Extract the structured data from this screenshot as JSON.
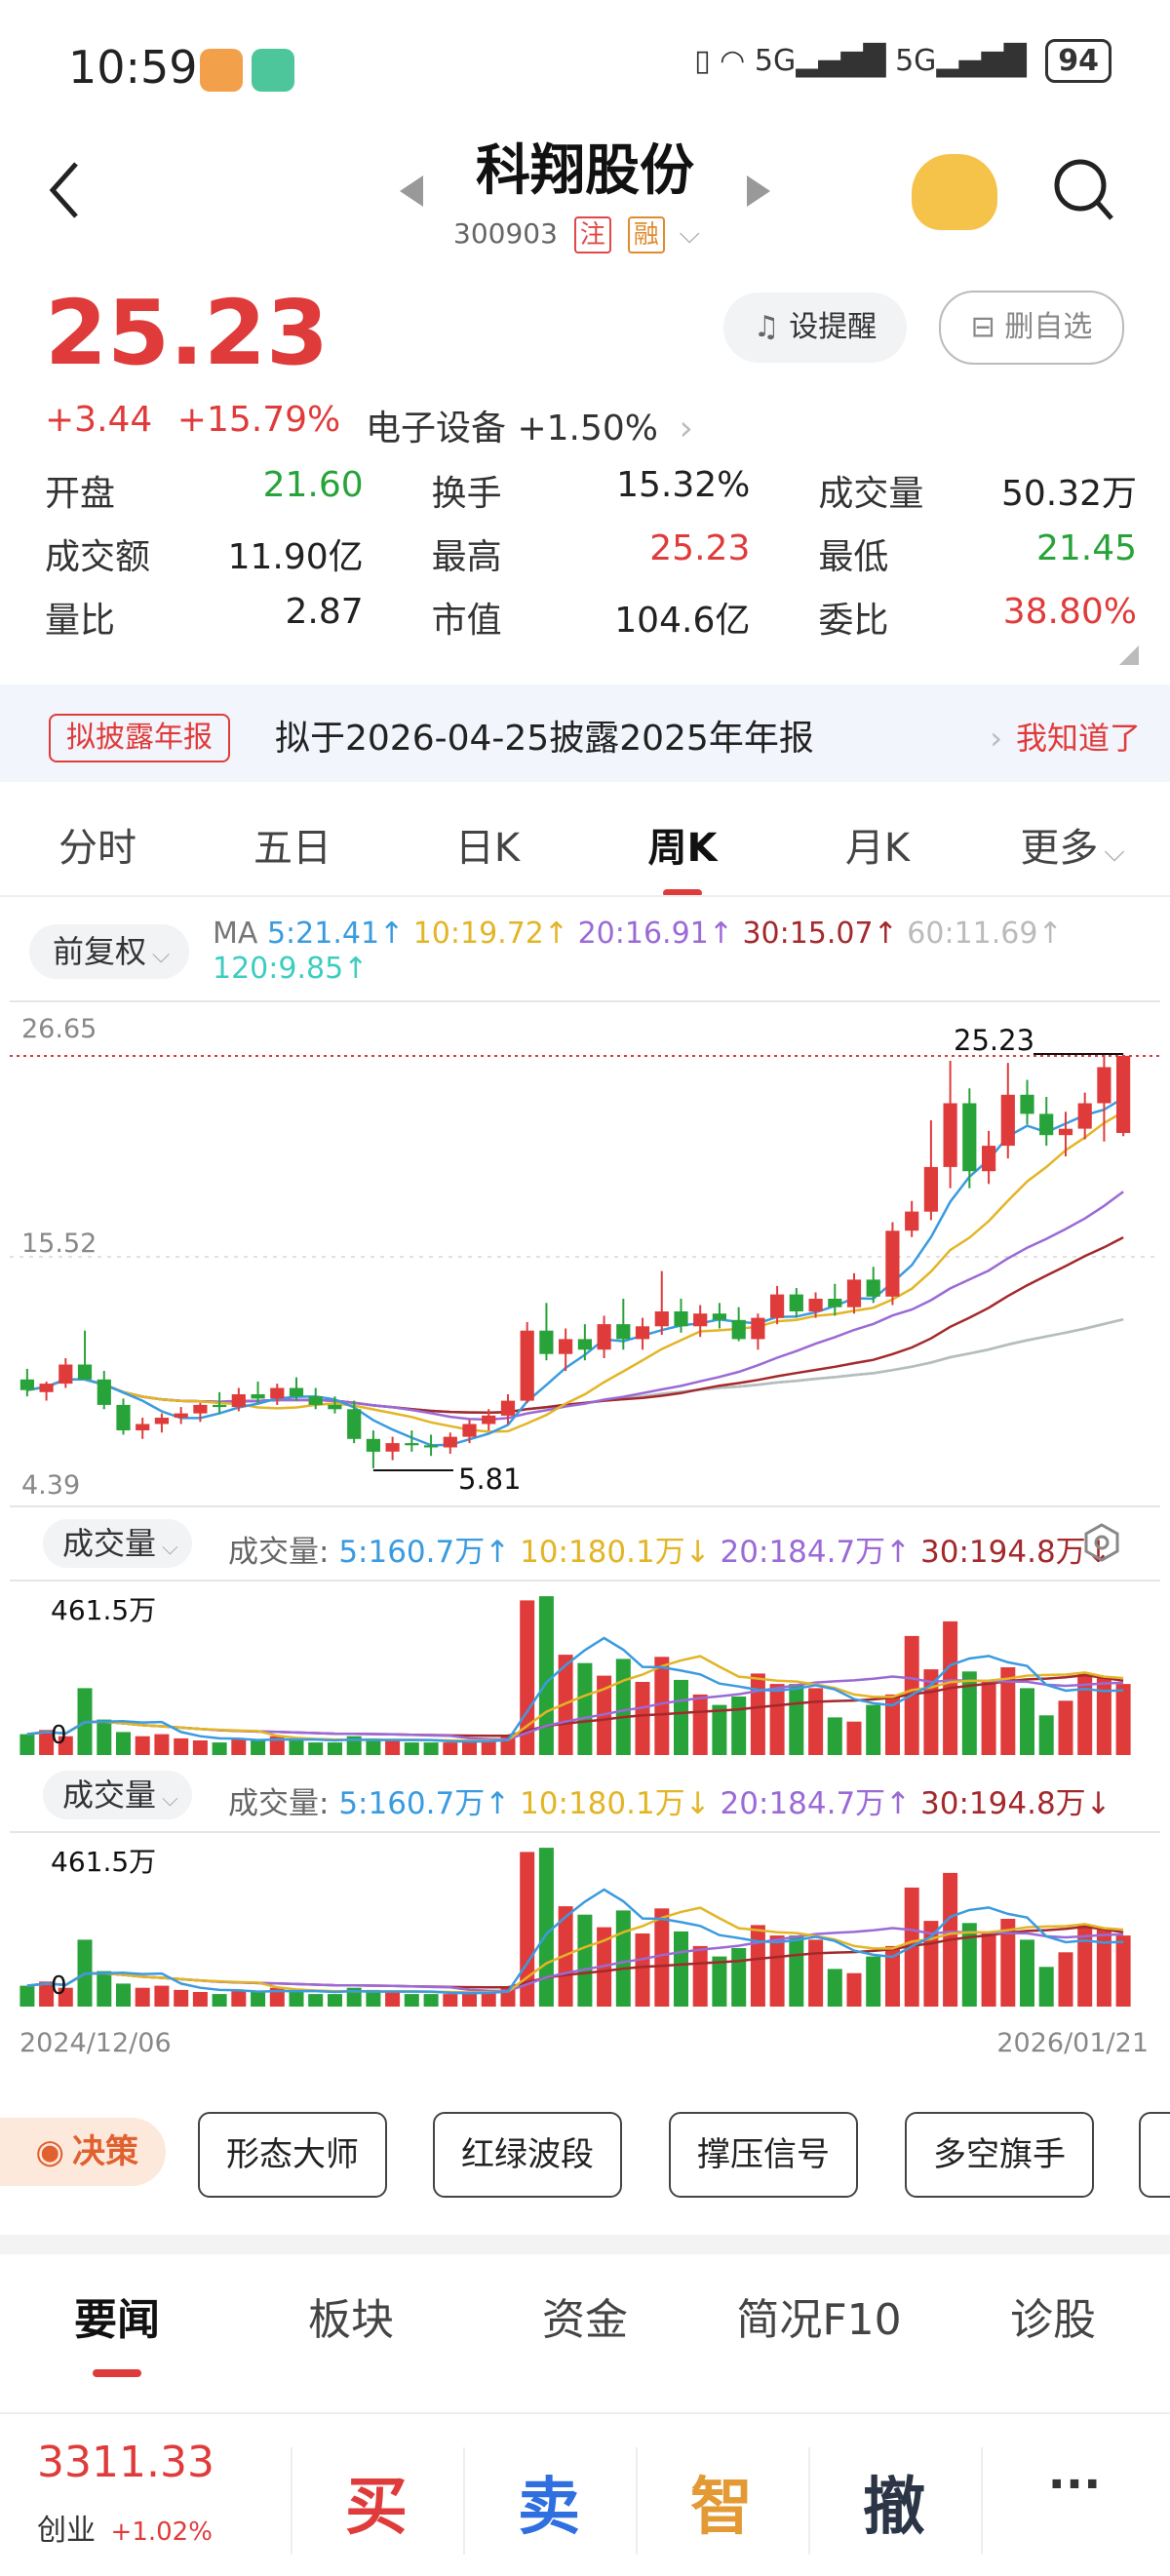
{
  "status_bar": {
    "time": "10:59",
    "network": "5G",
    "network2": "5G",
    "battery": "94"
  },
  "header": {
    "title": "科翔股份",
    "code": "300903",
    "tag1": "注",
    "tag2": "融"
  },
  "quote": {
    "price": "25.23",
    "change": "+3.44",
    "change_pct": "+15.79%",
    "sector": "电子设备 +1.50%",
    "alert_btn": "设提醒",
    "remove_btn": "删自选"
  },
  "stats": [
    [
      {
        "k": "开盘",
        "v": "21.60",
        "c": "green"
      },
      {
        "k": "换手",
        "v": "15.32%",
        "c": ""
      },
      {
        "k": "成交量",
        "v": "50.32万",
        "c": ""
      }
    ],
    [
      {
        "k": "成交额",
        "v": "11.90亿",
        "c": ""
      },
      {
        "k": "最高",
        "v": "25.23",
        "c": "red"
      },
      {
        "k": "最低",
        "v": "21.45",
        "c": "green"
      }
    ],
    [
      {
        "k": "量比",
        "v": "2.87",
        "c": ""
      },
      {
        "k": "市值",
        "v": "104.6亿",
        "c": ""
      },
      {
        "k": "委比",
        "v": "38.80%",
        "c": "red"
      }
    ]
  ],
  "notice": {
    "badge": "拟披露年报",
    "text": "拟于2026-04-25披露2025年年报",
    "action": "我知道了"
  },
  "chart_tabs": [
    "分时",
    "五日",
    "日K",
    "周K",
    "月K",
    "更多"
  ],
  "chart_tab_active": 3,
  "adjust": "前复权",
  "ma": {
    "label": "MA",
    "ma5": "5:21.41↑",
    "ma10": "10:19.72↑",
    "ma20": "20:16.91↑",
    "ma30": "30:15.07↑",
    "ma60": "60:11.69↑",
    "ma120": "120:9.85↑",
    "colors": {
      "ma5": "#3a9be0",
      "ma10": "#e3b526",
      "ma20": "#9b6ad6",
      "ma30": "#a4292c",
      "ma60": "#bbbbbb",
      "ma120": "#3ccdc0"
    }
  },
  "kline_axis": {
    "top": "26.65",
    "mid": "15.52",
    "bottom": "4.39",
    "high_label": "25.23",
    "low_label": "5.81"
  },
  "volume_panels": [
    {
      "selector": "成交量",
      "label": "成交量:",
      "v5": "5:160.7万↑",
      "v10": "10:180.1万↓",
      "v20": "20:184.7万↑",
      "v30": "30:194.8万↓",
      "max": "461.5万",
      "zero": "0"
    },
    {
      "selector": "成交量",
      "label": "成交量:",
      "v5": "5:160.7万↑",
      "v10": "10:180.1万↓",
      "v20": "20:184.7万↑",
      "v30": "30:194.8万↓",
      "max": "461.5万",
      "zero": "0"
    }
  ],
  "date_range": {
    "start": "2024/12/06",
    "end": "2026/01/21"
  },
  "strategy": {
    "title": "决策",
    "buttons": [
      "形态大师",
      "红绿波段",
      "撑压信号",
      "多空旗手"
    ]
  },
  "news_tabs": [
    "要闻",
    "板块",
    "资金",
    "简况F10",
    "诊股"
  ],
  "bottom": {
    "index_value": "3311.33",
    "index_name": "创业",
    "index_change": "+1.02%",
    "buy": "买",
    "sell": "卖",
    "smart": "智",
    "cancel": "撤",
    "more": "···"
  },
  "chart_data": {
    "type": "candlestick",
    "period": "weekly",
    "x_range": [
      "2024/12/06",
      "2026/01/21"
    ],
    "y_range": [
      4.39,
      26.65
    ],
    "ohlc": [
      [
        10.0,
        10.5,
        9.2,
        9.5
      ],
      [
        9.4,
        9.9,
        9.0,
        9.8
      ],
      [
        9.8,
        11.0,
        9.6,
        10.7
      ],
      [
        10.7,
        12.3,
        10.3,
        10.0
      ],
      [
        10.0,
        10.4,
        8.6,
        8.8
      ],
      [
        8.8,
        9.1,
        7.4,
        7.6
      ],
      [
        7.6,
        8.2,
        7.2,
        7.9
      ],
      [
        7.9,
        8.4,
        7.5,
        8.2
      ],
      [
        8.2,
        8.7,
        7.9,
        8.4
      ],
      [
        8.4,
        8.9,
        8.0,
        8.8
      ],
      [
        8.8,
        9.4,
        8.4,
        8.7
      ],
      [
        8.7,
        9.6,
        8.5,
        9.3
      ],
      [
        9.3,
        9.9,
        8.9,
        9.1
      ],
      [
        9.1,
        9.8,
        8.8,
        9.6
      ],
      [
        9.6,
        10.1,
        9.0,
        9.2
      ],
      [
        9.2,
        9.6,
        8.6,
        8.8
      ],
      [
        8.8,
        9.2,
        8.4,
        8.6
      ],
      [
        8.6,
        9.0,
        7.0,
        7.2
      ],
      [
        7.2,
        7.6,
        5.81,
        6.6
      ],
      [
        6.6,
        7.3,
        6.2,
        7.0
      ],
      [
        7.0,
        7.6,
        6.6,
        6.9
      ],
      [
        6.9,
        7.4,
        6.4,
        6.8
      ],
      [
        6.8,
        7.5,
        6.5,
        7.3
      ],
      [
        7.3,
        8.1,
        7.0,
        7.9
      ],
      [
        7.9,
        8.6,
        7.6,
        8.3
      ],
      [
        8.3,
        9.3,
        7.9,
        9.0
      ],
      [
        9.0,
        12.7,
        8.9,
        12.3
      ],
      [
        12.3,
        13.6,
        10.9,
        11.2
      ],
      [
        11.2,
        12.4,
        10.4,
        11.9
      ],
      [
        11.9,
        12.6,
        10.9,
        11.4
      ],
      [
        11.4,
        13.0,
        11.0,
        12.6
      ],
      [
        12.6,
        13.8,
        11.4,
        11.9
      ],
      [
        11.9,
        12.9,
        11.4,
        12.5
      ],
      [
        12.5,
        15.1,
        12.1,
        13.2
      ],
      [
        13.2,
        13.8,
        12.2,
        12.5
      ],
      [
        12.5,
        13.5,
        12.0,
        13.1
      ],
      [
        13.1,
        13.6,
        12.4,
        12.8
      ],
      [
        12.8,
        13.4,
        11.8,
        11.9
      ],
      [
        11.9,
        13.1,
        11.4,
        12.9
      ],
      [
        12.9,
        14.4,
        12.6,
        14.0
      ],
      [
        14.0,
        14.3,
        12.9,
        13.2
      ],
      [
        13.2,
        14.1,
        12.9,
        13.8
      ],
      [
        13.8,
        14.5,
        13.0,
        13.4
      ],
      [
        13.4,
        15.0,
        13.1,
        14.7
      ],
      [
        14.7,
        15.3,
        13.6,
        13.9
      ],
      [
        13.9,
        17.4,
        13.5,
        17.0
      ],
      [
        17.0,
        18.4,
        16.7,
        17.9
      ],
      [
        17.9,
        22.2,
        17.5,
        20.0
      ],
      [
        20.0,
        25.0,
        19.0,
        23.0
      ],
      [
        23.0,
        23.7,
        19.0,
        19.8
      ],
      [
        19.8,
        21.7,
        19.2,
        21.0
      ],
      [
        21.0,
        24.9,
        20.4,
        23.4
      ],
      [
        23.4,
        24.1,
        22.0,
        22.5
      ],
      [
        22.5,
        23.3,
        21.0,
        21.5
      ],
      [
        21.5,
        22.6,
        20.5,
        21.8
      ],
      [
        21.8,
        23.5,
        21.3,
        23.0
      ],
      [
        23.0,
        25.3,
        21.2,
        24.7
      ],
      [
        21.6,
        25.23,
        21.45,
        25.23
      ]
    ],
    "volume": [
      1.0,
      1.2,
      0.9,
      3.2,
      1.7,
      1.1,
      0.9,
      1.0,
      0.8,
      0.7,
      0.6,
      0.8,
      0.7,
      0.9,
      0.7,
      0.6,
      0.6,
      0.9,
      0.8,
      0.7,
      0.6,
      0.6,
      0.6,
      0.7,
      0.8,
      0.9,
      7.4,
      7.6,
      4.8,
      4.4,
      3.8,
      4.6,
      3.5,
      4.7,
      3.6,
      2.9,
      2.4,
      2.8,
      3.9,
      3.4,
      3.4,
      3.2,
      1.8,
      1.6,
      2.4,
      2.9,
      5.7,
      4.1,
      6.4,
      4.0,
      3.5,
      4.2,
      3.2,
      1.9,
      2.6,
      3.9,
      3.7,
      3.4
    ],
    "volume_unit": "万(×100)"
  }
}
